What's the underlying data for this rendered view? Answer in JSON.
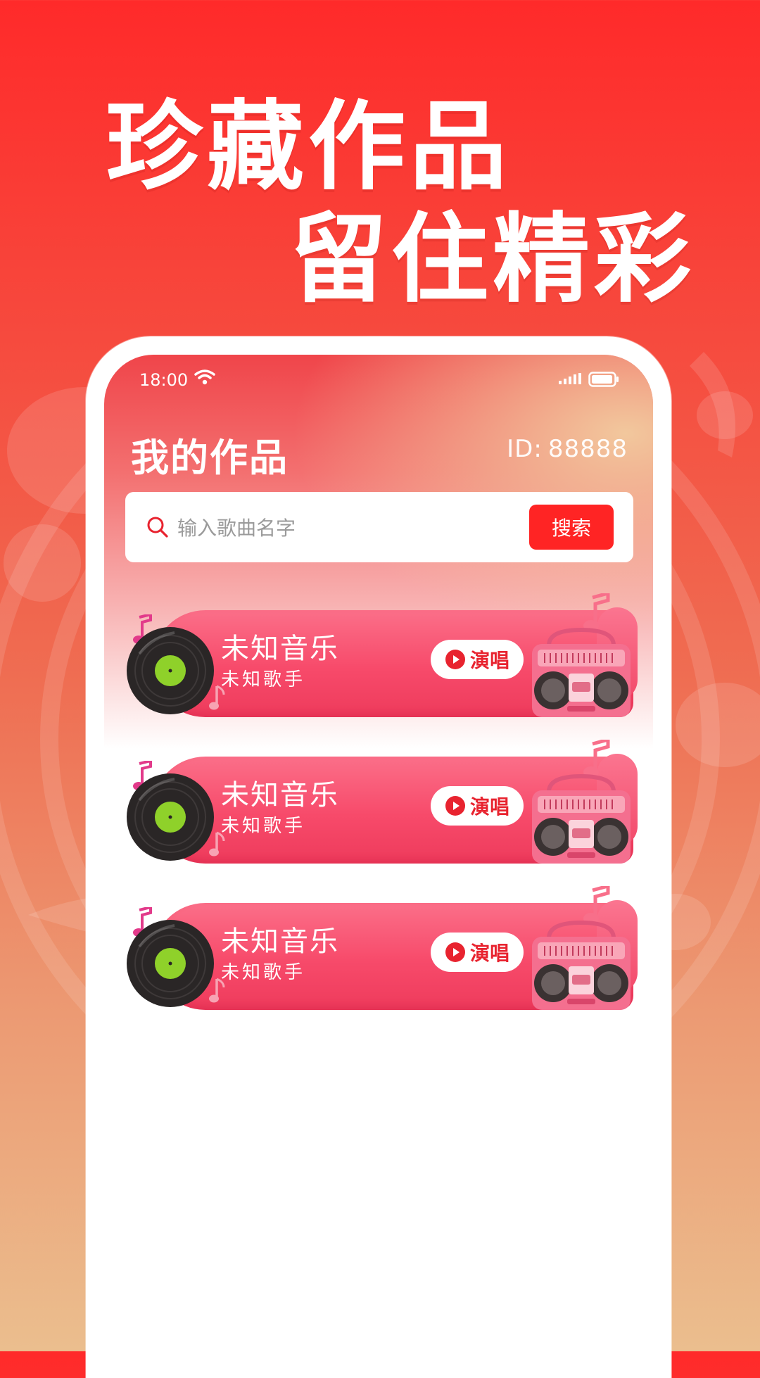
{
  "promo": {
    "headline_line1": "珍藏作品",
    "headline_line2": "留住精彩"
  },
  "status_bar": {
    "time": "18:00"
  },
  "header": {
    "title": "我的作品",
    "id_label": "ID:",
    "id_value": "88888"
  },
  "search": {
    "placeholder": "输入歌曲名字",
    "button_label": "搜索"
  },
  "songs": [
    {
      "title": "未知音乐",
      "artist": "未知歌手",
      "action_label": "演唱"
    },
    {
      "title": "未知音乐",
      "artist": "未知歌手",
      "action_label": "演唱"
    },
    {
      "title": "未知音乐",
      "artist": "未知歌手",
      "action_label": "演唱"
    }
  ],
  "colors": {
    "accent_red": "#ff2424",
    "card_pink": "#f74a6a",
    "vinyl_label_green": "#8fd12a"
  },
  "icons": [
    "wifi-icon",
    "signal-icon",
    "battery-icon",
    "search-icon",
    "play-icon",
    "vinyl-record-icon",
    "boombox-icon",
    "music-note-icon"
  ]
}
